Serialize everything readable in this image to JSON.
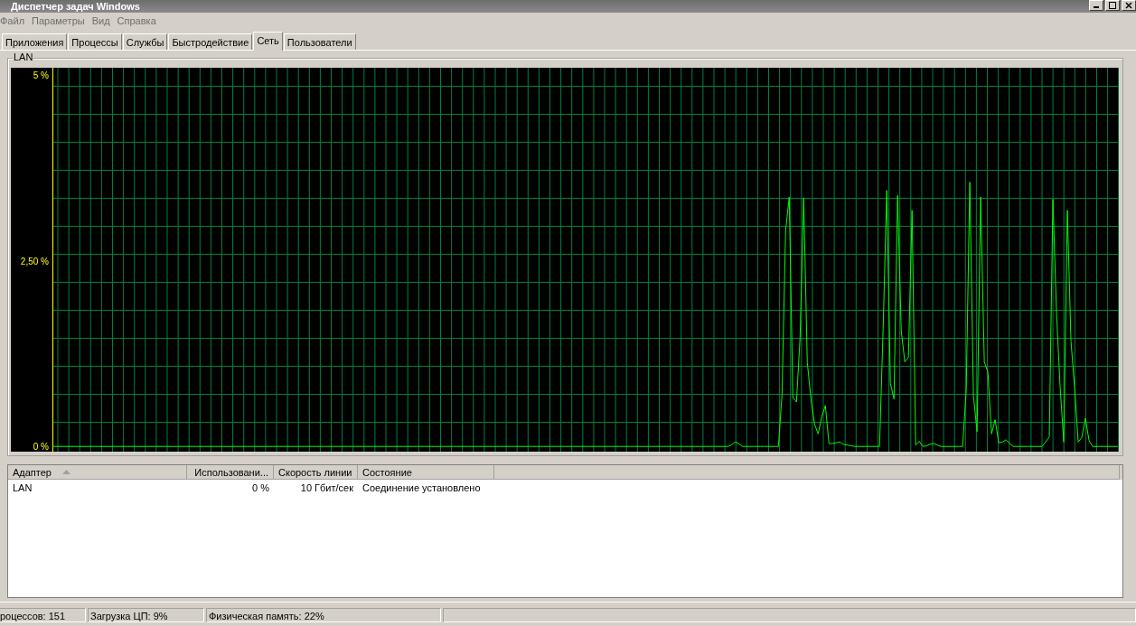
{
  "window": {
    "title": "Диспетчер задач Windows"
  },
  "menu": [
    "Файл",
    "Параметры",
    "Вид",
    "Справка"
  ],
  "tabs": [
    {
      "label": "Приложения",
      "selected": false
    },
    {
      "label": "Процессы",
      "selected": false
    },
    {
      "label": "Службы",
      "selected": false
    },
    {
      "label": "Быстродействие",
      "selected": false
    },
    {
      "label": "Сеть",
      "selected": true
    },
    {
      "label": "Пользователи",
      "selected": false
    }
  ],
  "network_graph": {
    "chart_data": {
      "type": "line",
      "categories": [
        null,
        null,
        null,
        null,
        null,
        null,
        null,
        null,
        null,
        null,
        null,
        null,
        null,
        null,
        null,
        null,
        null,
        null,
        null,
        null,
        null,
        null,
        null,
        null,
        null,
        null,
        null,
        null,
        null,
        null,
        null,
        null,
        null,
        null,
        null,
        null,
        null,
        null,
        null,
        null,
        null,
        null,
        null,
        null,
        null,
        null,
        null,
        null,
        null,
        null,
        null,
        null,
        null,
        null,
        null,
        null,
        null,
        null,
        null,
        null,
        null,
        null,
        null,
        null,
        null,
        null,
        null,
        null,
        null,
        null,
        null,
        null,
        null,
        null,
        null,
        null,
        null,
        null,
        null,
        null,
        null,
        null,
        null,
        null,
        null,
        null,
        null,
        null,
        null,
        null,
        null,
        null,
        null,
        null,
        null,
        null,
        null,
        null,
        null,
        null,
        null,
        null,
        null,
        null,
        null,
        null,
        null,
        null,
        null,
        null,
        null,
        null,
        null,
        null,
        null,
        null,
        null,
        null,
        null,
        null,
        null,
        null,
        null,
        null,
        null,
        null,
        null,
        null,
        null,
        null,
        null,
        null,
        null,
        null,
        null,
        null,
        null,
        null,
        null,
        null,
        null,
        null,
        null,
        null,
        null,
        null,
        null,
        null,
        null,
        null,
        null,
        null,
        null,
        null,
        null,
        null,
        null,
        null,
        null,
        null,
        null,
        null,
        null,
        null,
        null,
        null,
        null,
        null,
        null,
        null,
        null,
        null,
        null,
        null,
        null,
        null,
        null,
        null,
        null,
        null,
        null,
        null,
        null,
        null,
        null,
        null,
        null,
        null,
        null,
        null,
        null,
        null,
        null,
        null,
        null,
        null,
        null,
        null,
        null,
        null,
        null,
        null,
        null,
        null,
        null,
        null,
        null,
        null,
        null,
        null,
        null,
        null,
        null,
        null,
        null,
        null,
        null,
        null,
        null,
        null,
        null,
        null,
        null,
        null,
        null,
        null,
        null,
        null,
        null,
        null,
        null,
        null,
        null,
        null,
        null,
        null,
        null,
        null,
        null,
        null,
        null,
        null,
        null,
        null,
        null,
        null,
        null,
        null,
        null,
        null,
        null,
        null,
        null,
        null,
        null,
        null,
        null,
        null,
        null,
        null,
        null,
        null,
        null,
        null,
        null,
        null,
        null,
        null,
        null,
        null,
        null,
        null,
        null,
        null,
        null,
        null,
        null,
        null,
        null,
        null,
        null,
        null,
        null,
        null,
        null,
        null,
        null,
        null,
        null,
        null,
        null,
        null,
        null,
        null,
        null,
        null
      ],
      "series": [
        {
          "name": "LAN",
          "color": "#00ff00",
          "values": [
            0,
            0,
            0,
            0,
            0,
            0,
            0,
            0,
            0,
            0,
            0,
            0,
            0,
            0,
            0,
            0,
            0,
            0,
            0,
            0,
            0,
            0,
            0,
            0,
            0,
            0,
            0,
            0,
            0,
            0,
            0,
            0,
            0,
            0,
            0,
            0,
            0,
            0,
            0,
            0,
            0,
            0,
            0,
            0,
            0,
            0,
            0,
            0,
            0,
            0,
            0,
            0,
            0,
            0,
            0,
            0,
            0,
            0,
            0,
            0,
            0,
            0,
            0,
            0,
            0,
            0,
            0,
            0,
            0,
            0,
            0,
            0,
            0,
            0,
            0,
            0,
            0,
            0,
            0,
            0,
            0,
            0,
            0,
            0,
            0,
            0,
            0,
            0,
            0,
            0,
            0,
            0,
            0,
            0,
            0,
            0,
            0,
            0,
            0,
            0,
            0,
            0,
            0,
            0,
            0,
            0,
            0,
            0,
            0,
            0,
            0,
            0,
            0,
            0,
            0,
            0,
            0,
            0,
            0,
            0,
            0,
            0,
            0,
            0,
            0,
            0,
            0,
            0,
            0,
            0,
            0,
            0,
            0,
            0,
            0,
            0,
            0,
            0,
            0,
            0,
            0,
            0,
            0,
            0,
            0,
            0,
            0,
            0,
            0,
            0,
            0,
            0,
            0,
            0,
            0,
            0,
            0,
            0,
            0,
            0,
            0,
            0,
            0,
            0,
            0,
            0,
            0,
            0,
            0,
            0,
            0,
            0,
            0,
            0,
            0,
            0,
            0,
            0,
            0,
            0,
            0,
            0,
            0,
            0,
            0,
            0,
            0,
            0,
            0.02,
            0.06,
            0.04,
            0,
            0,
            0,
            0,
            0,
            0,
            0,
            0,
            0,
            0,
            0,
            0.7,
            2.91,
            3.36,
            0.66,
            0.6,
            1.47,
            3.35,
            1.13,
            0.65,
            0.3,
            0.17,
            0.4,
            0.55,
            0.04,
            0.04,
            0.05,
            0.06,
            0.03,
            0.02,
            0.01,
            0,
            0,
            0,
            0,
            0,
            0,
            0,
            0,
            1.6,
            3.45,
            0.85,
            0.64,
            3.38,
            1.56,
            1.14,
            1.2,
            3.18,
            0.02,
            0.07,
            0,
            0.01,
            0.03,
            0.04,
            0.02,
            0,
            0,
            0,
            0,
            0,
            0,
            0,
            0.76,
            3.56,
            0.68,
            0.2,
            3.36,
            1.14,
            1.0,
            0.17,
            0.36,
            0.05,
            0.06,
            0.09,
            0.04,
            0,
            0,
            0,
            0,
            0,
            0,
            0,
            0,
            0,
            0.06,
            0.13,
            3.33,
            1.8,
            0.8,
            0.06,
            3.18,
            1.42,
            0.8,
            0.06,
            0.12,
            0.38,
            0.08,
            0,
            0,
            0,
            0,
            0,
            0,
            0,
            0
          ]
        }
      ],
      "ylim": [
        -0.07,
        5.1
      ],
      "yticks": [
        {
          "value": 5,
          "label": "5 %"
        },
        {
          "value": 2.5,
          "label": "2,50 %"
        },
        {
          "value": 0,
          "label": "0 %"
        }
      ]
    }
  },
  "table": {
    "columns": [
      {
        "label": "Адаптер",
        "sorted": true
      },
      {
        "label": "Использовани...",
        "sorted": false
      },
      {
        "label": "Скорость линии",
        "sorted": false
      },
      {
        "label": "Состояние",
        "sorted": false
      }
    ],
    "rows": [
      [
        "LAN",
        "0 %",
        "10 Гбит/сек",
        "Соединение установлено"
      ]
    ]
  },
  "status_bar": [
    "роцессов: 151",
    "Загрузка ЦП: 9%",
    "Физическая память: 22%"
  ]
}
